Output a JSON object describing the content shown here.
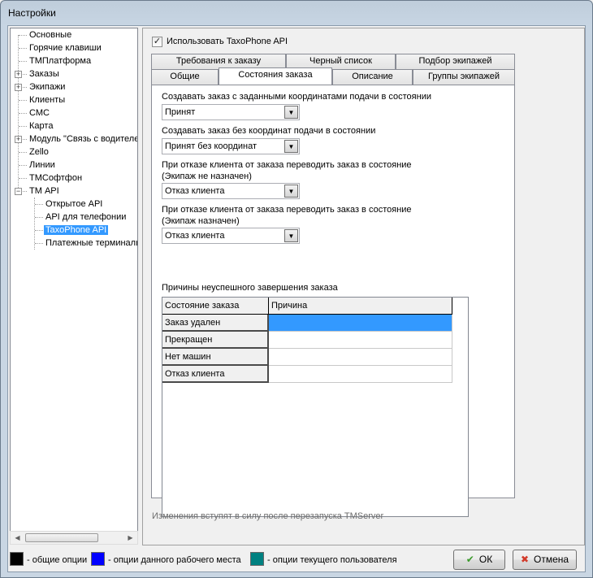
{
  "window": {
    "title": "Настройки"
  },
  "tree": {
    "items": [
      {
        "label": "Основные"
      },
      {
        "label": "Горячие клавиши"
      },
      {
        "label": "ТМПлатформа"
      },
      {
        "label": "Заказы",
        "expander": "+"
      },
      {
        "label": "Экипажи",
        "expander": "+"
      },
      {
        "label": "Клиенты"
      },
      {
        "label": "СМС"
      },
      {
        "label": "Карта"
      },
      {
        "label": "Модуль \"Связь с водителем\"",
        "expander": "+"
      },
      {
        "label": "Zello"
      },
      {
        "label": "Линии"
      },
      {
        "label": "ТМСофтфон"
      },
      {
        "label": "ТМ API",
        "expander": "−"
      },
      {
        "label": "Открытое API"
      },
      {
        "label": "API для телефонии"
      },
      {
        "label": "TaxoPhone API",
        "selected": true
      },
      {
        "label": "Платежные терминалы"
      }
    ],
    "scroll_left_icon": "scroll-left-arrow",
    "scroll_right_icon": "scroll-right-arrow"
  },
  "settings": {
    "use_api_label": "Использовать TaxoPhone API",
    "use_api_checked": true,
    "check_glyph": "✓"
  },
  "tabs": {
    "row1": [
      "Требования к заказу",
      "Черный список",
      "Подбор экипажей"
    ],
    "row2": [
      "Общие",
      "Состояния заказа",
      "Описание",
      "Группы экипажей"
    ],
    "active": "Состояния заказа"
  },
  "form": {
    "field1": {
      "label": "Создавать заказ с заданными координатами подачи в состоянии",
      "value": "Принят"
    },
    "field2": {
      "label": "Создавать заказ без координат подачи в состоянии",
      "value": "Принят без координат"
    },
    "field3": {
      "label_line1": "При отказе клиента от заказа переводить заказ в состояние",
      "label_line2": "(Экипаж не назначен)",
      "value": "Отказ клиента"
    },
    "field4": {
      "label_line1": "При отказе клиента от заказа переводить заказ в состояние",
      "label_line2": "(Экипаж назначен)",
      "value": "Отказ клиента"
    },
    "dropdown_glyph": "▼"
  },
  "reasons": {
    "title": "Причины неуспешного завершения заказа",
    "columns": [
      "Состояние заказа",
      "Причина"
    ],
    "rows": [
      {
        "state": "Заказ удален",
        "reason": "",
        "selected": true
      },
      {
        "state": "Прекращен",
        "reason": ""
      },
      {
        "state": "Нет машин",
        "reason": ""
      },
      {
        "state": "Отказ клиента",
        "reason": ""
      }
    ]
  },
  "note": "Изменения вступят в силу после перезапуска TMServer",
  "legend": [
    {
      "color": "#000000",
      "label": "- общие опции"
    },
    {
      "color": "#0000ff",
      "label": "- опции данного рабочего места"
    },
    {
      "color": "#008080",
      "label": "- опции текущего пользователя"
    }
  ],
  "buttons": {
    "ok_label": "ОК",
    "ok_icon_glyph": "✔",
    "ok_icon_color": "#3a9a2a",
    "cancel_label": "Отмена",
    "cancel_icon_glyph": "✖",
    "cancel_icon_color": "#d23a2a"
  }
}
